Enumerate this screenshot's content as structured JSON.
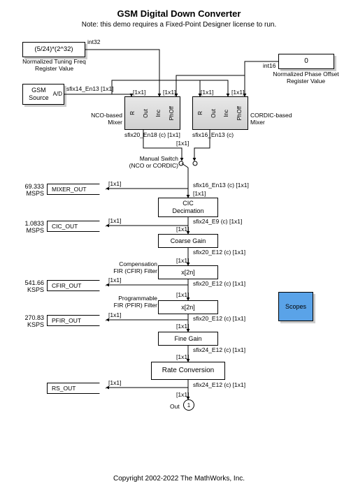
{
  "title": "GSM Digital Down Converter",
  "note": "Note: this demo requires a Fixed-Point Designer license to run.",
  "copyright": "Copyright 2002-2022 The MathWorks, Inc.",
  "tuning_freq": {
    "value": "(5/24)*(2^32)",
    "label": "Normalized Tuning Freq\nRegister Value",
    "dtype": "int32"
  },
  "phase_offset": {
    "value": "0",
    "label": "Normalized Phase Offset\nRegister Value",
    "dtype": "int16"
  },
  "gsm_source": {
    "label": "GSM\nSource",
    "ad": "A/D",
    "out_dtype": "sfix14_En13 [1x1]"
  },
  "mixer_nco": {
    "label": "NCO-based\nMixer",
    "ports": [
      "R",
      "Out",
      "Inc",
      "PhOff"
    ],
    "out_dtype": "sfix20_En18 (c) [1x1]"
  },
  "mixer_cordic": {
    "label": "CORDIC-based\nMixer",
    "ports": [
      "R",
      "Out",
      "Inc",
      "PhOff"
    ],
    "out_dtype": "sfix16_En13 (c)"
  },
  "switch": {
    "label": "Manual Switch\n(NCO or CORDIC)",
    "out_dtype": "sfix16_En13 (c) [1x1]"
  },
  "chain": [
    {
      "name": "CIC\nDecimation",
      "out": "sfix24_E9 (c) [1x1]"
    },
    {
      "name": "Coarse Gain",
      "out": "sfix20_E12 (c) [1x1]"
    },
    {
      "name": "x[2n]",
      "pre": "Compensation\nFIR (CFIR) Filter",
      "out": "sfix20_E12 (c) [1x1]"
    },
    {
      "name": "x[2n]",
      "pre": "Programmable\nFIR (PFIR) Filter",
      "out": "sfix20_E12 (c) [1x1]"
    },
    {
      "name": "Fine Gain",
      "out": "sfix24_E12 (c) [1x1]"
    },
    {
      "name": "Rate Conversion",
      "out": "sfix24_E12 (c) [1x1]"
    }
  ],
  "taps": [
    {
      "rate": "69.333\nMSPS",
      "tag": "MIXER_OUT"
    },
    {
      "rate": "1.0833\nMSPS",
      "tag": "CIC_OUT"
    },
    {
      "rate": "541.66\nKSPS",
      "tag": "CFIR_OUT"
    },
    {
      "rate": "270.83\nKSPS",
      "tag": "PFIR_OUT"
    },
    {
      "rate": "",
      "tag": "RS_OUT"
    }
  ],
  "sig11": "[1x1]",
  "out": {
    "label": "Out",
    "num": "1"
  },
  "scopes": "Scopes"
}
